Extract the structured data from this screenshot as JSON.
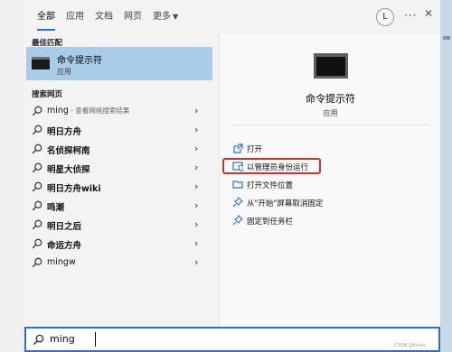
{
  "tabs": [
    {
      "label": "全部",
      "active": true
    },
    {
      "label": "应用"
    },
    {
      "label": "文档"
    },
    {
      "label": "网页"
    },
    {
      "label": "更多",
      "has_caret": true
    }
  ],
  "header": {
    "avatar_letter": "L",
    "more_icon": "ellipsis-icon",
    "close_icon": "close-icon"
  },
  "best_match": {
    "heading": "最佳匹配",
    "title": "命令提示符",
    "subtitle": "应用",
    "icon": "cmd-icon"
  },
  "web_search": {
    "heading": "搜索网页",
    "items": [
      {
        "text": "ming",
        "hint": " - 查看网络搜索结果",
        "bold": false
      },
      {
        "text": "明日方舟",
        "bold": true
      },
      {
        "text": "名侦探柯南",
        "bold": true
      },
      {
        "text": "明星大侦探",
        "bold": true
      },
      {
        "text": "明日方舟wiki",
        "bold": true
      },
      {
        "text": "鸣潮",
        "bold": true
      },
      {
        "text": "明日之后",
        "bold": true
      },
      {
        "text": "命运方舟",
        "bold": true
      },
      {
        "text": "mingw",
        "bold": false
      }
    ]
  },
  "detail": {
    "title": "命令提示符",
    "subtitle": "应用",
    "actions": [
      {
        "label": "打开",
        "icon": "open-icon"
      },
      {
        "label": "以管理员身份运行",
        "icon": "admin-shield-icon",
        "highlighted": true
      },
      {
        "label": "打开文件位置",
        "icon": "folder-icon"
      },
      {
        "label": "从\"开始\"屏幕取消固定",
        "icon": "unpin-icon"
      },
      {
        "label": "固定到任务栏",
        "icon": "pin-taskbar-icon"
      }
    ]
  },
  "search": {
    "query": "ming"
  },
  "watermark": "CSDN @Kevin...",
  "colors": {
    "accent": "#2f6fcb",
    "selection": "#a9cde8",
    "highlight_border": "#d32f2f"
  }
}
